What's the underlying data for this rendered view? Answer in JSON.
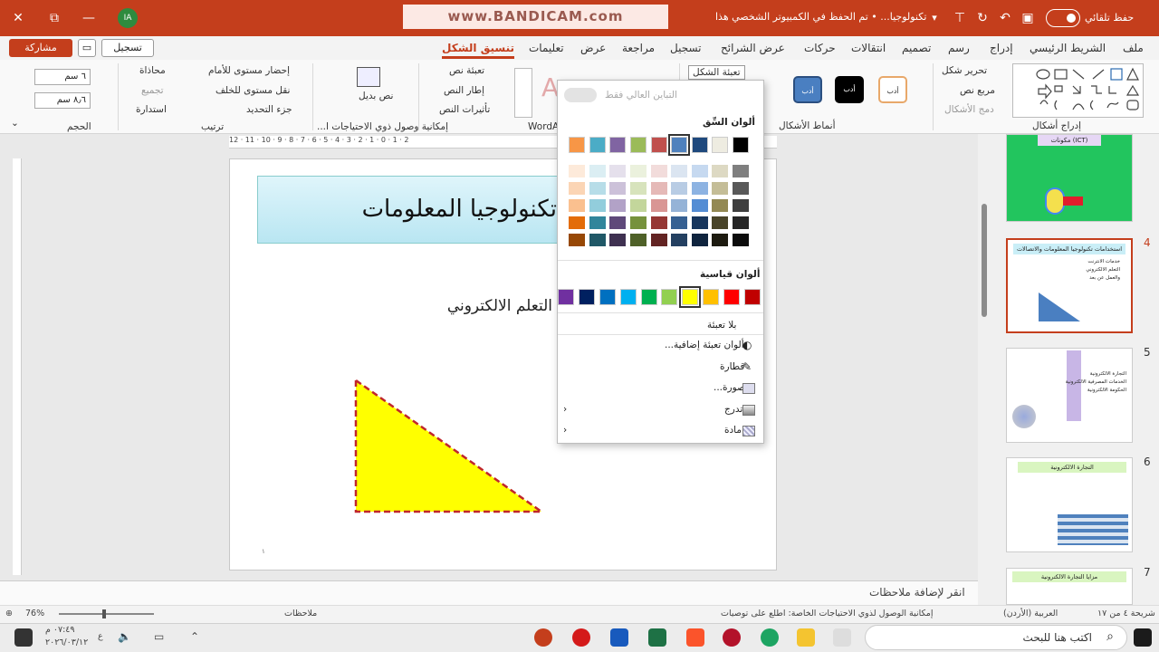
{
  "titlebar": {
    "autosave_label": "حفظ تلقائي",
    "doc_title": "تكنولوجيا... • تم الحفظ في الكمبيوتر الشخصي هذا",
    "avatar_initials": "IA",
    "watermark": "www.BANDICAM.com",
    "close_glyph": "✕",
    "restore_glyph": "⧉",
    "minimize_glyph": "—"
  },
  "tabs": [
    "ملف",
    "الشريط الرئيسي",
    "إدراج",
    "رسم",
    "تصميم",
    "انتقالات",
    "حركات",
    "عرض الشرائح",
    "تسجيل",
    "مراجعة",
    "عرض",
    "تعليمات",
    "تنسيق الشكل"
  ],
  "active_tab": "تنسيق الشكل",
  "share_label": "مشاركة",
  "record_label": "تسجيل",
  "ribbon": {
    "insert_shapes_group": "إدراج أشكال",
    "edit_shape": "تحرير شكل",
    "text_box": "مربع نص",
    "merge_shapes": "دمج الأشكال",
    "styles_group": "أنماط الأشكال",
    "style_label": "أدب",
    "shape_fill": "تعبئة الشكل",
    "wordart_group": "WordArt",
    "text_fill": "تعبئة نص",
    "text_outline": "إطار النص",
    "text_effects": "تأثيرات النص",
    "alt_text": "نص بديل",
    "accessibility_group": "إمكانية وصول ذوي الاحتياجات ا...",
    "bring_forward": "إحضار مستوى للأمام",
    "send_backward": "نقل مستوى للخلف",
    "selection_pane": "جزء التحديد",
    "align": "محاذاة",
    "group": "تجميع",
    "rotate": "استدارة",
    "arrange_group": "ترتيب",
    "height": "٦ سم",
    "width": "٨٫٦ سم",
    "size_group": "الحجم"
  },
  "ruler_text": "12 · 11 · 10 · 9 · 8 · 7 · 6 · 5 · 4 · 3 · 2 · 1 · 0 · 1 · 2",
  "slide": {
    "title": "تكنولوجيا المعلومات والاتصالات",
    "subtitle": "التعلم الالكتروني",
    "page_number": "١"
  },
  "triangle": {
    "fill": "#ffff00",
    "stroke": "#c0262c"
  },
  "fill_popup": {
    "high_contrast_only": "التباين العالي فقط",
    "theme_colors_title": "ألوان السِّق",
    "theme_colors": [
      "#000000",
      "#eeece1",
      "#1f497d",
      "#4f81bd",
      "#c0504d",
      "#9bbb59",
      "#8064a2",
      "#4bacc6",
      "#f79646"
    ],
    "theme_shades": [
      [
        "#7f7f7f",
        "#595959",
        "#3f3f3f",
        "#262626",
        "#0c0c0c"
      ],
      [
        "#ddd9c3",
        "#c4bd97",
        "#938953",
        "#494429",
        "#1d1b10"
      ],
      [
        "#c6d9f0",
        "#8db3e2",
        "#548dd4",
        "#17365d",
        "#0f243e"
      ],
      [
        "#dbe5f1",
        "#b8cce4",
        "#95b3d7",
        "#366092",
        "#244061"
      ],
      [
        "#f2dcdb",
        "#e5b9b7",
        "#d99694",
        "#953734",
        "#632423"
      ],
      [
        "#ebf1dd",
        "#d7e3bc",
        "#c3d69b",
        "#76923c",
        "#4f6128"
      ],
      [
        "#e5e0ec",
        "#ccc1d9",
        "#b2a2c7",
        "#5f497a",
        "#3f3151"
      ],
      [
        "#dbeef3",
        "#b7dde8",
        "#92cddc",
        "#31859b",
        "#205867"
      ],
      [
        "#fdeada",
        "#fbd5b5",
        "#fac08f",
        "#e36c09",
        "#974806"
      ]
    ],
    "selected_theme_index": 3,
    "standard_colors_title": "ألوان قياسية",
    "standard_colors": [
      "#c00000",
      "#ff0000",
      "#ffc000",
      "#ffff00",
      "#92d050",
      "#00b050",
      "#00b0f0",
      "#0070c0",
      "#002060",
      "#7030a0"
    ],
    "selected_standard_index": 3,
    "no_fill": "بلا تعبئة",
    "more_fill_colors": "ألوان تعبئة إضافية...",
    "eyedropper": "قطارة",
    "picture": "صورة...",
    "gradient": "تدرج",
    "texture": "مادة"
  },
  "thumbnails": [
    {
      "number": "",
      "title": "مكونات (ICT)",
      "bg": "#22c55e"
    },
    {
      "number": "4",
      "title": "استخدامات تكنولوجيا المعلومات والاتصالات",
      "items": [
        "خدمات الانترنت",
        "التعلم الالكتروني",
        "والعمل عن بعد"
      ]
    },
    {
      "number": "5",
      "title": "",
      "items": [
        "التجارة الالكترونية",
        "الخدمات المصرفية الالكترونية",
        "الحكومة الالكترونية"
      ]
    },
    {
      "number": "6",
      "title": "التجارة الالكترونية"
    },
    {
      "number": "7",
      "title": "مزايا التجارة الالكترونية"
    }
  ],
  "notes_placeholder": "انقر لإضافة ملاحظات",
  "status": {
    "slide_count": "شريحة ٤ من ١٧",
    "language": "العربية (الأردن)",
    "accessibility": "إمكانية الوصول لذوي الاحتياجات الخاصة: اطلع على توصيات",
    "notes": "ملاحظات",
    "zoom": "76%"
  },
  "taskbar": {
    "search_placeholder": "اكتب هنا للبحث",
    "time": "٠٧:٤٩ م",
    "date": "٢٠٢٦/٠٣/١٢",
    "lang": "ع"
  }
}
